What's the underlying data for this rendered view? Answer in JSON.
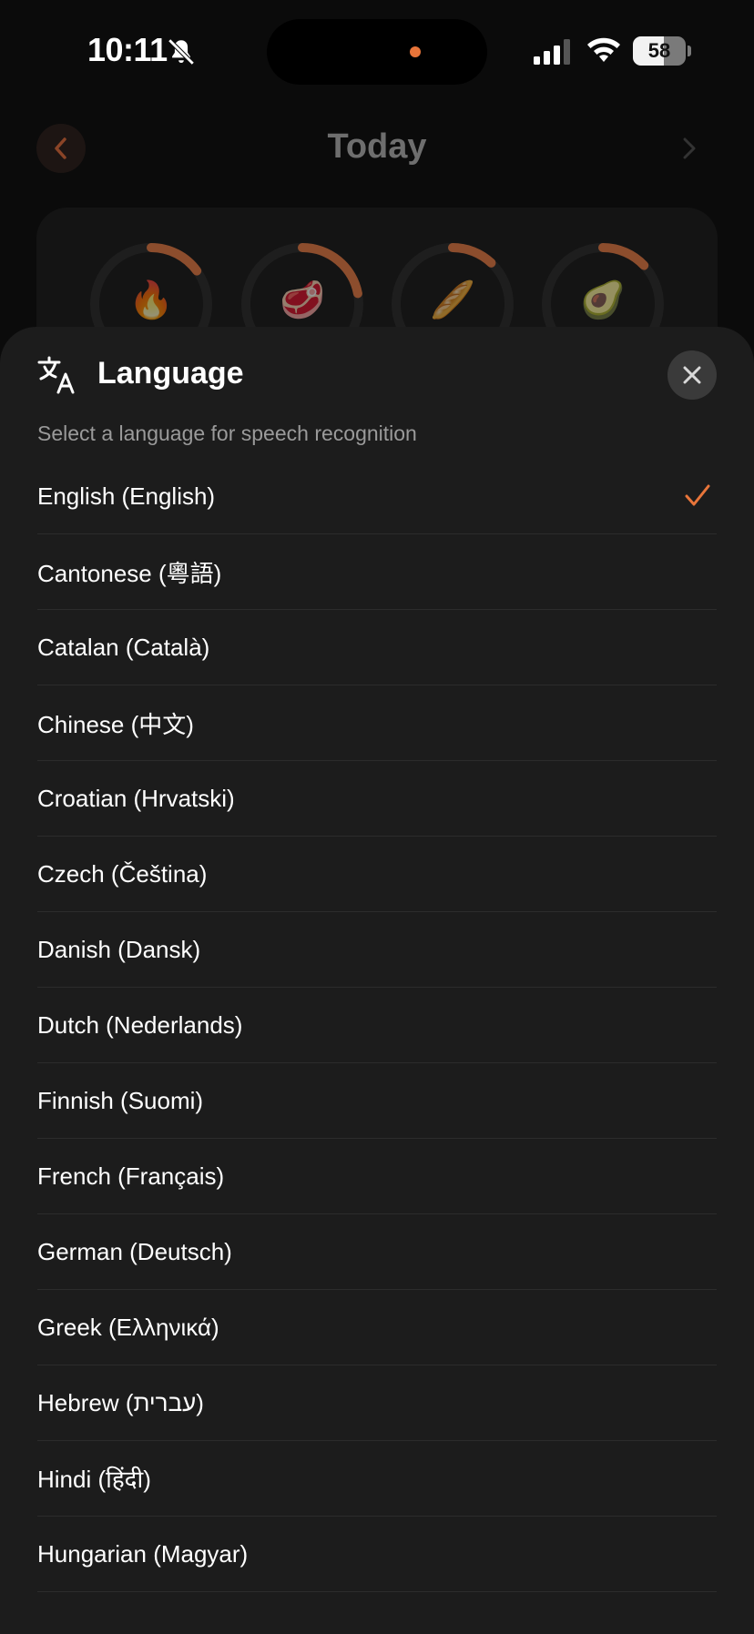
{
  "status_bar": {
    "time": "10:11",
    "battery": "58",
    "battery_level": 0.58,
    "accent_color": "#e8753a"
  },
  "screen": {
    "title": "Today",
    "macro_rings": [
      {
        "icon": "fire-icon",
        "emoji": "🔥",
        "progress": 0.15
      },
      {
        "icon": "steak-icon",
        "emoji": "🥩",
        "progress": 0.22
      },
      {
        "icon": "bread-icon",
        "emoji": "🥖",
        "progress": 0.12
      },
      {
        "icon": "avocado-icon",
        "emoji": "🥑",
        "progress": 0.13
      }
    ]
  },
  "sheet": {
    "title": "Language",
    "subtitle": "Select a language for speech recognition",
    "selected": "English (English)",
    "languages": [
      "English (English)",
      "Cantonese (粵語)",
      "Catalan (Català)",
      "Chinese (中文)",
      "Croatian (Hrvatski)",
      "Czech (Čeština)",
      "Danish (Dansk)",
      "Dutch (Nederlands)",
      "Finnish (Suomi)",
      "French (Français)",
      "German (Deutsch)",
      "Greek (Ελληνικά)",
      "Hebrew (עברית)",
      "Hindi (हिंदी)",
      "Hungarian (Magyar)"
    ]
  }
}
